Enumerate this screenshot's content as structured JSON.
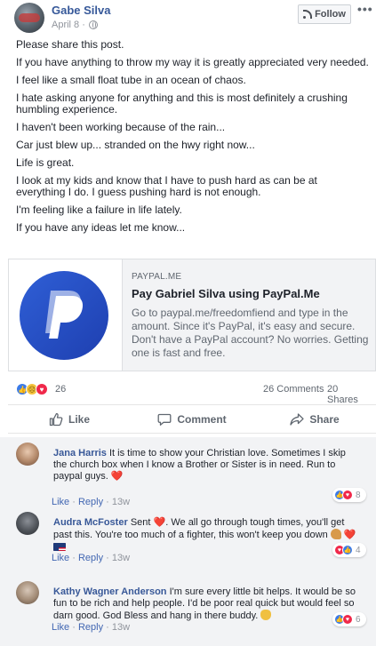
{
  "post": {
    "author": "Gabe Silva",
    "date": "April 8 ·",
    "follow_label": "Follow",
    "more_label": "•••",
    "lines": [
      "Please share this post.",
      "If you have anything to throw my way it is greatly appreciated very needed.",
      "I feel like a small float tube in an ocean of chaos.",
      "I hate asking anyone for anything and this is most definitely a crushing humbling experience.",
      "I haven't been working because of the rain...",
      "Car just blew up... stranded on the hwy right now...",
      "Life is great.",
      "I look at my kids and know that I have to push hard as can be at everything I do. I guess pushing hard is not enough.",
      "I'm feeling like a failure in life lately.",
      "If you have any ideas let me know..."
    ]
  },
  "link": {
    "domain": "PAYPAL.ME",
    "title": "Pay Gabriel Silva using PayPal.Me",
    "description": "Go to paypal.me/freedomfiend and type in the amount. Since it's PayPal, it's easy and secure. Don't have a PayPal account? No worries. Getting one is fast and free."
  },
  "stats": {
    "reactions": "26",
    "comments": "26 Comments",
    "shares": "20 Shares"
  },
  "actions": {
    "like": "Like",
    "comment": "Comment",
    "share": "Share"
  },
  "comments": [
    {
      "name": "Jana Harris",
      "text": "It is time to show your Christian love. Sometimes I skip the church box when I know a Brother or Sister is in need. Run to paypal guys.",
      "like": "Like",
      "sep1": "·",
      "reply": "Reply",
      "sep2": "·",
      "time": "13w",
      "reaction_count": "8"
    },
    {
      "name": "Audra McFoster",
      "text_before": "Sent",
      "text_after": ". We all go through tough times, you'll get past this. You're too much of a fighter, this won't keep you down",
      "like": "Like",
      "sep1": "·",
      "reply": "Reply",
      "sep2": "·",
      "time": "13w",
      "reaction_count": "4"
    },
    {
      "name": "Kathy Wagner Anderson",
      "text": "I'm sure every little bit helps. It would be so fun to be rich and help people. I'd be poor real quick but would feel so darn good. God Bless and hang in there buddy.",
      "like": "Like",
      "sep1": "·",
      "reply": "Reply",
      "sep2": "·",
      "time": "13w",
      "reaction_count": "6"
    }
  ],
  "colors": {
    "link_blue": "#365899",
    "paypal_blue": "#2f5fd6",
    "heart_red": "#e0245e",
    "like_blue": "#3b7be8"
  },
  "icons": [
    "globe-icon",
    "rss-icon",
    "paypal-logo",
    "like-icon",
    "comment-icon",
    "share-icon",
    "heart-icon",
    "sad-icon"
  ]
}
